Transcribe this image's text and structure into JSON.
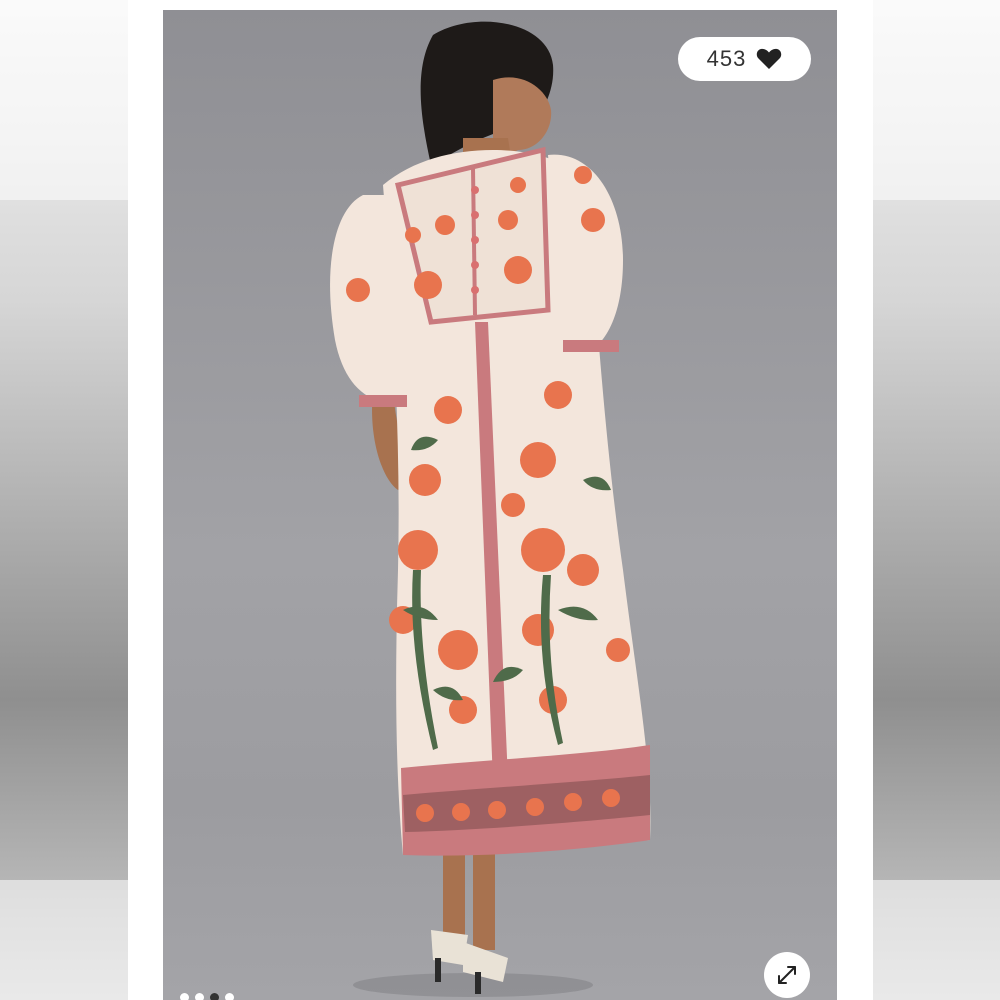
{
  "product_image": {
    "alt": ""
  },
  "likes": {
    "count": "453",
    "icon": "heart-icon"
  },
  "expand": {
    "icon": "expand-arrows-icon"
  },
  "gallery": {
    "dot_count": 4,
    "active_index": 2
  },
  "colors": {
    "photo_background": "#9a9a9e",
    "card_background": "#ffffff",
    "pill_background": "#ffffff",
    "heart": "#222222",
    "dress_base": "#f3e6dc",
    "dress_floral": "#e8744e",
    "dress_border": "#c97a7e",
    "leaf": "#4f6b4a"
  }
}
